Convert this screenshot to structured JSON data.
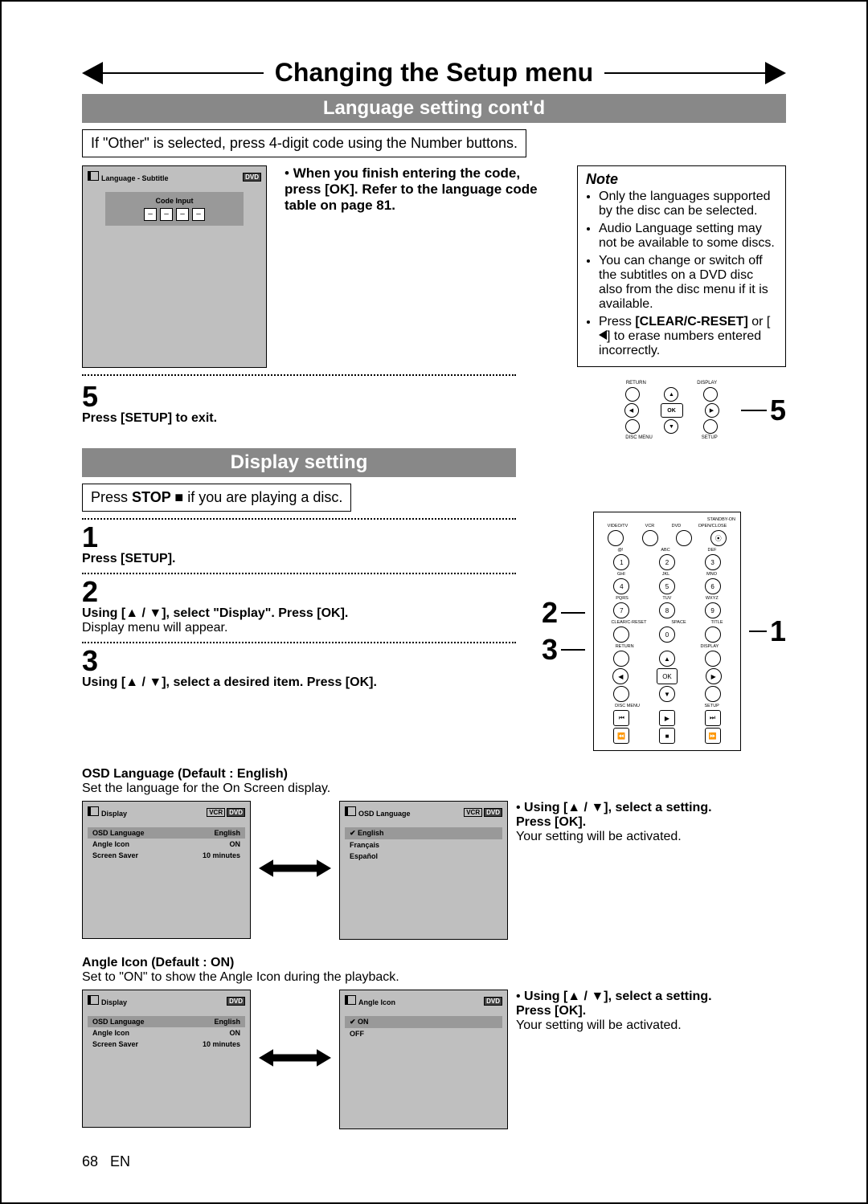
{
  "page_title": "Changing the Setup menu",
  "section1": {
    "bar": "Language setting cont'd",
    "box": "If \"Other\" is selected, press 4-digit code using the Number buttons.",
    "screen_header": "Language - Subtitle",
    "screen_tag": "DVD",
    "code_input_label": "Code Input",
    "code_cell": "–",
    "mid_bullet": "When you finish entering the code, press [OK]. Refer to the language code table on page 81.",
    "note_title": "Note",
    "note_items": [
      "Only the languages supported by the disc can be selected.",
      "Audio Language setting may not be available to some discs.",
      "You can change or switch off the subtitles on a DVD disc also from the disc menu if it is available.",
      "Press [CLEAR/C-RESET] or [◀] to erase numbers entered incorrectly."
    ]
  },
  "step5": {
    "num": "5",
    "text_bold": "Press [SETUP] to exit.",
    "callout": "5"
  },
  "remote_labels": {
    "return": "RETURN",
    "display": "DISPLAY",
    "ok": "OK",
    "disc_menu": "DISC MENU",
    "setup": "SETUP"
  },
  "section2": {
    "bar": "Display setting",
    "box_pre": "Press ",
    "box_bold": "STOP",
    "box_post": " if you are playing a disc."
  },
  "steps": {
    "s1": {
      "num": "1",
      "text": "Press [SETUP]."
    },
    "s2": {
      "num": "2",
      "text": "Using [▲ / ▼], select \"Display\". Press [OK].",
      "sub": "Display menu will appear."
    },
    "s3": {
      "num": "3",
      "text": "Using [▲ / ▼], select a desired item. Press [OK]."
    }
  },
  "callouts": {
    "c2": "2",
    "c3": "3",
    "c1": "1"
  },
  "remote_full": {
    "standby": "STANDBY-ON",
    "top_row": [
      "VIDEO/TV",
      "VCR",
      "DVD",
      "OPEN/CLOSE"
    ],
    "num_labels": [
      "@!",
      "ABC",
      "DEF",
      "GHI",
      "JKL",
      "MNO",
      "PQRS",
      "TUV",
      "WXYZ"
    ],
    "clear": "CLEAR/C-RESET",
    "space": "SPACE",
    "title": "TITLE"
  },
  "osd": {
    "heading": "OSD Language (Default : English)",
    "desc": "Set the language for the On Screen display.",
    "display_header": "Display",
    "tags": [
      "VCR",
      "DVD"
    ],
    "rows": [
      [
        "OSD Language",
        "English"
      ],
      [
        "Angle Icon",
        "ON"
      ],
      [
        "Screen Saver",
        "10 minutes"
      ]
    ],
    "osd_header": "OSD Language",
    "osd_options": [
      "English",
      "Français",
      "Español"
    ],
    "instr_bold": "Using [▲ / ▼], select a setting. Press [OK].",
    "instr_plain": "Your setting will be activated."
  },
  "angle": {
    "heading": "Angle Icon (Default : ON)",
    "desc": "Set to \"ON\" to show the Angle Icon during the playback.",
    "display_header": "Display",
    "tag": "DVD",
    "rows": [
      [
        "OSD Language",
        "English"
      ],
      [
        "Angle Icon",
        "ON"
      ],
      [
        "Screen Saver",
        "10 minutes"
      ]
    ],
    "angle_header": "Angle Icon",
    "angle_options": [
      "ON",
      "OFF"
    ],
    "instr_bold": "Using [▲ / ▼], select a setting. Press [OK].",
    "instr_plain": "Your setting will be activated."
  },
  "footer": {
    "page": "68",
    "lang": "EN"
  }
}
